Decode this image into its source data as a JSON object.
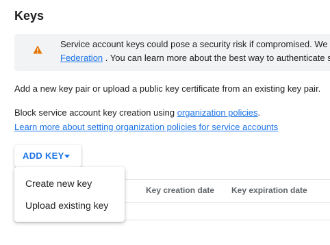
{
  "title": "Keys",
  "warning": {
    "icon": "warning-icon",
    "line1": "Service account keys could pose a security risk if compromised. We",
    "link_federation": "Federation",
    "line2_rest": " . You can learn more about the best way to authenticate s"
  },
  "intro": "Add a new key pair or upload a public key certificate from an existing key pair.",
  "block_text": "Block service account key creation using ",
  "block_link": "organization policies",
  "block_period": ".",
  "learn_more_link": "Learn more about setting organization policies for service accounts",
  "add_key": {
    "label": "ADD KEY",
    "icon": "caret-down-icon"
  },
  "menu": {
    "items": [
      {
        "label": "Create new key"
      },
      {
        "label": "Upload existing key"
      }
    ]
  },
  "table": {
    "headers": {
      "created": "Key creation date",
      "expires": "Key expiration date"
    }
  },
  "colors": {
    "accent": "#1a73e8",
    "warning": "#e37400",
    "banner_bg": "#f1f3f4"
  }
}
